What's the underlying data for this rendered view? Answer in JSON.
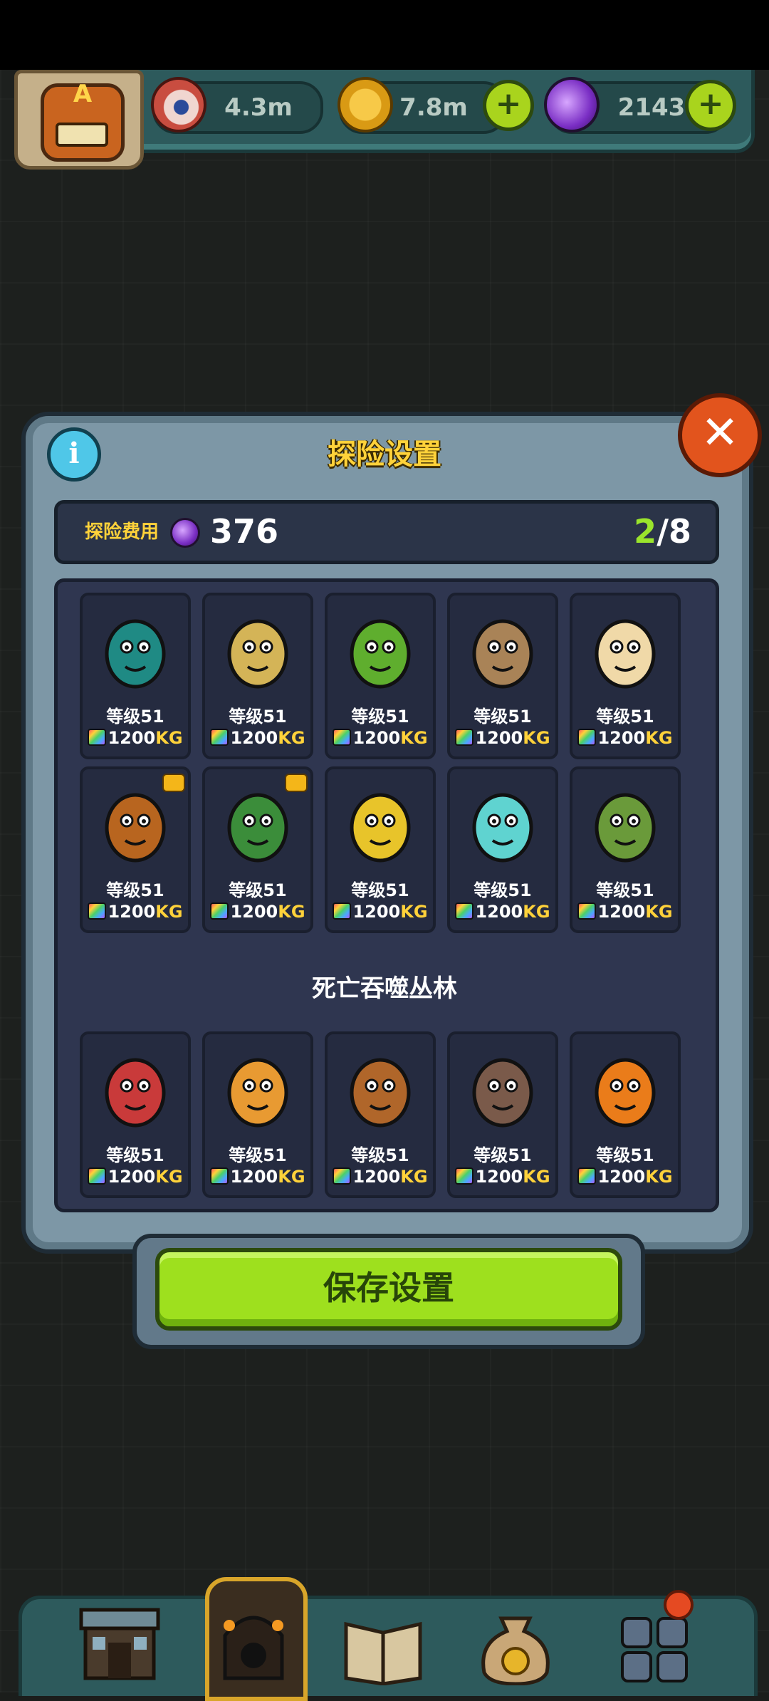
{
  "resources": {
    "eyeball_amount": "4.3m",
    "coin_amount": "7.8m",
    "potion_amount": "2143"
  },
  "modal": {
    "title": "探险设置",
    "cost_label": "探险费用",
    "cost_value": "376",
    "slots_current": "2",
    "slots_total": "/8",
    "section_title": "死亡吞噬丛林",
    "save_label": "保存设置"
  },
  "monsters_top": [
    {
      "name": "teal-birds",
      "level": "等级51",
      "weight": "1200",
      "unit": "KG",
      "tag": false
    },
    {
      "name": "wheat-plant",
      "level": "等级51",
      "weight": "1200",
      "unit": "KG",
      "tag": false
    },
    {
      "name": "cabbage",
      "level": "等级51",
      "weight": "1200",
      "unit": "KG",
      "tag": false
    },
    {
      "name": "sack-creature",
      "level": "等级51",
      "weight": "1200",
      "unit": "KG",
      "tag": false
    },
    {
      "name": "egg-chick",
      "level": "等级51",
      "weight": "1200",
      "unit": "KG",
      "tag": false
    },
    {
      "name": "horned-beast",
      "level": "等级51",
      "weight": "1200",
      "unit": "KG",
      "tag": true
    },
    {
      "name": "tree-spirit",
      "level": "等级51",
      "weight": "1200",
      "unit": "KG",
      "tag": true
    },
    {
      "name": "corn",
      "level": "等级51",
      "weight": "1200",
      "unit": "KG",
      "tag": false
    },
    {
      "name": "ghost",
      "level": "等级51",
      "weight": "1200",
      "unit": "KG",
      "tag": false
    },
    {
      "name": "cactus-plant",
      "level": "等级51",
      "weight": "1200",
      "unit": "KG",
      "tag": false
    }
  ],
  "monsters_bottom": [
    {
      "name": "red-toad",
      "level": "等级51",
      "weight": "1200",
      "unit": "KG",
      "tag": false
    },
    {
      "name": "mushroom-cow",
      "level": "等级51",
      "weight": "1200",
      "unit": "KG",
      "tag": false
    },
    {
      "name": "monkey",
      "level": "等级51",
      "weight": "1200",
      "unit": "KG",
      "tag": false
    },
    {
      "name": "chainsaw-pig",
      "level": "等级51",
      "weight": "1200",
      "unit": "KG",
      "tag": false
    },
    {
      "name": "pumpkin",
      "level": "等级51",
      "weight": "1200",
      "unit": "KG",
      "tag": false
    }
  ],
  "nav": [
    {
      "icon": "shop-icon"
    },
    {
      "icon": "dungeon-icon"
    },
    {
      "icon": "book-icon"
    },
    {
      "icon": "money-bag-icon"
    },
    {
      "icon": "grid-menu-icon"
    }
  ],
  "colors": {
    "accent_yellow": "#ffd23a",
    "save_green": "#9ee01e",
    "close_orange": "#e2541d",
    "info_blue": "#4fc7e8",
    "slot_green": "#9be52c"
  }
}
